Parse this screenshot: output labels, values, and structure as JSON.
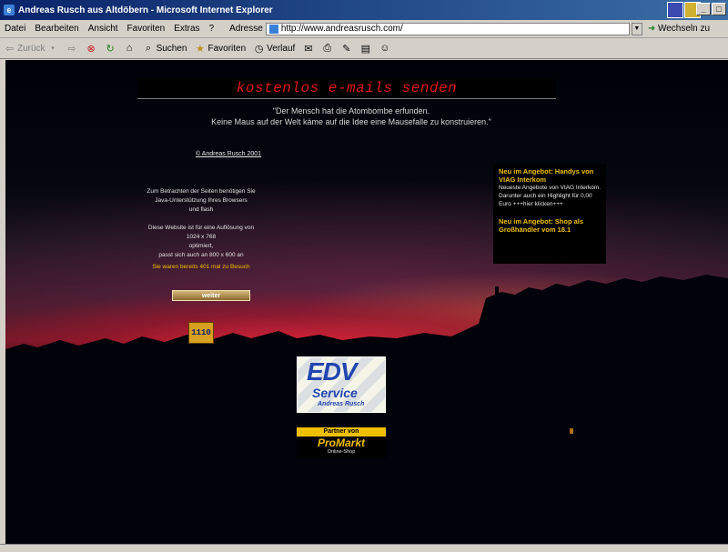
{
  "window": {
    "title": "Andreas Rusch aus Altdöbern - Microsoft Internet Explorer",
    "minimize": "_",
    "maximize": "□",
    "close": "×"
  },
  "menu": {
    "items": [
      "Datei",
      "Bearbeiten",
      "Ansicht",
      "Favoriten",
      "Extras",
      "?"
    ],
    "address_label": "Adresse",
    "address_value": "http://www.andreasrusch.com/",
    "go_label": "Wechseln zu"
  },
  "toolbar": {
    "back": "Zurück",
    "search": "Suchen",
    "favorites": "Favoriten",
    "history": "Verlauf"
  },
  "page": {
    "heading": "kostenlos e-mails senden",
    "quote_line1": "\"Der Mensch hat die Atombombe erfunden.",
    "quote_line2": "Keine Maus auf der Welt käme auf die Idee eine Mausefalle zu konstruieren.\"",
    "copyright": "© Andreas Rusch 2001",
    "java_line1": "Zum Betrachten der Seiten benötigen Sie",
    "java_line2": "Java-Unterstützung Ihres Browsers",
    "java_line3": "und flash",
    "res_line1": "Diese Website ist für eine Auflösung von",
    "res_line2": "1024 x 768",
    "res_line3": "optimiert,",
    "res_line4": "passt sich auch an 800 x 600 an",
    "visits": "Sie waren bereits 401 mal zu Besuch",
    "weiter_button": "weiter",
    "counter": "1110"
  },
  "news": {
    "title1": "Neu im Angebot: Handys von VIAG Interkom",
    "body1": "Neueste Angebote von VIAG Interkom. Darunter auch ein Highlight für 0,00 Euro +++hier klicken+++",
    "title2": "Neu im Angebot: Shop als Großhändler vom 18.1"
  },
  "edv_logo": {
    "line1": "EDV",
    "line2": "Service",
    "line3": "Andreas Rusch"
  },
  "promarkt_logo": {
    "partner": "Partner von",
    "brand": "ProMarkt",
    "shop": "Online-Shop"
  },
  "colors": {
    "heading": "#e01818",
    "accent": "#f0c000",
    "titlebar_start": "#0a246a"
  }
}
